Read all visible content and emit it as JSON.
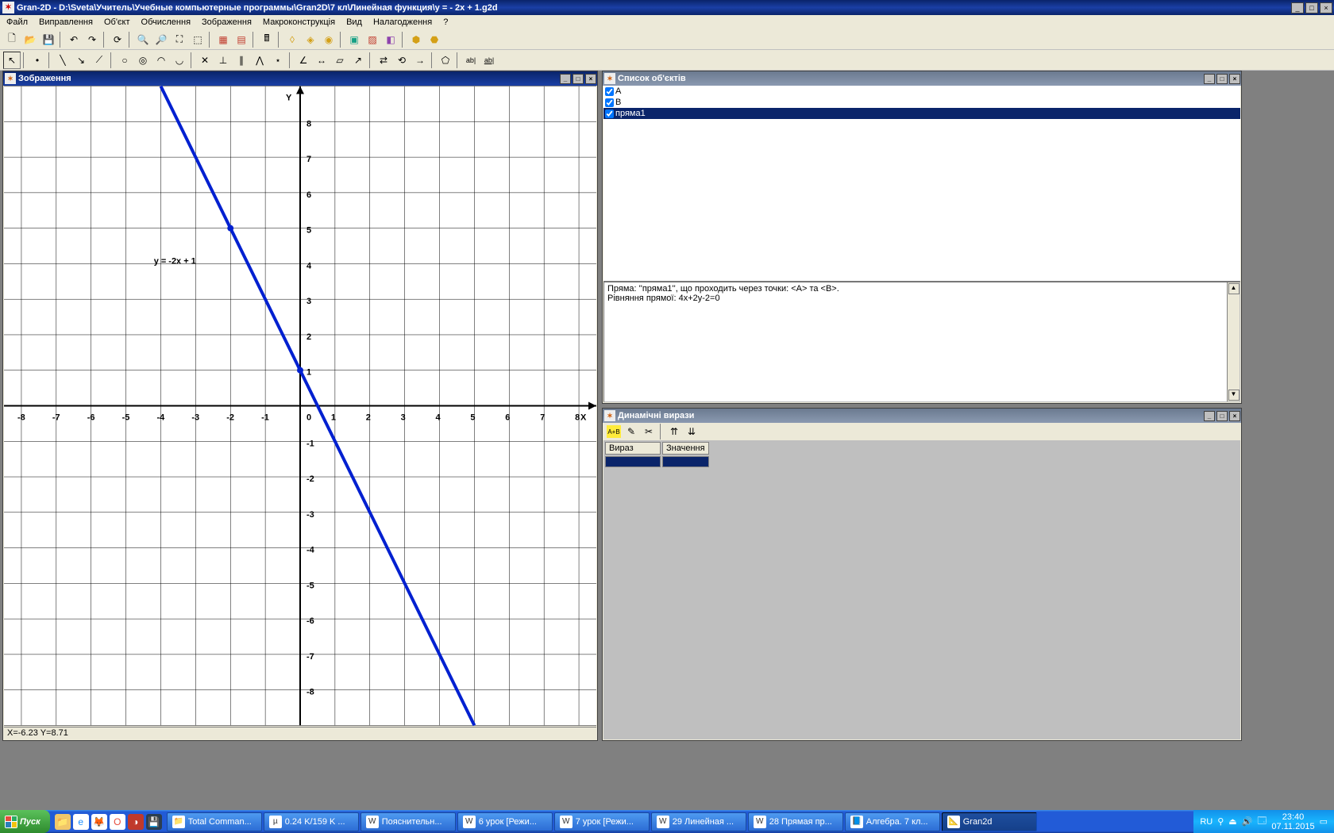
{
  "titlebar": {
    "app": "Gran-2D",
    "path": " - D:\\Sveta\\Учитель\\Учебные компьютерные программы\\Gran2D\\7 кл\\Линейная функция\\y = - 2x + 1.g2d"
  },
  "menu": [
    "Файл",
    "Виправлення",
    "Об'єкт",
    "Обчислення",
    "Зображення",
    "Макроконструкція",
    "Вид",
    "Налагодження",
    "?"
  ],
  "panels": {
    "plot": {
      "title": "Зображення",
      "status": "X=-6.23 Y=8.71"
    },
    "list": {
      "title": "Список об'єктів",
      "items": [
        {
          "label": "A",
          "checked": true,
          "selected": false
        },
        {
          "label": "B",
          "checked": true,
          "selected": false
        },
        {
          "label": "пряма1",
          "checked": true,
          "selected": true
        }
      ],
      "info1": "Пряма: ''пряма1'', що проходить через точки: <A> та <B>.",
      "info2": "Рівняння прямої: 4x+2y-2=0"
    },
    "dyn": {
      "title": "Динамічні вирази",
      "col1": "Вираз",
      "col2": "Значення"
    }
  },
  "chart_data": {
    "type": "line",
    "title": "y = -2x + 1",
    "xlabel": "X",
    "ylabel": "Y",
    "xlim": [
      -8.5,
      8.5
    ],
    "ylim": [
      -9,
      9
    ],
    "xticks": [
      -8,
      -7,
      -6,
      -5,
      -4,
      -3,
      -2,
      -1,
      0,
      1,
      2,
      3,
      4,
      5,
      6,
      7,
      8
    ],
    "yticks": [
      -8,
      -7,
      -6,
      -5,
      -4,
      -3,
      -2,
      -1,
      1,
      2,
      3,
      4,
      5,
      6,
      7,
      8
    ],
    "series": [
      {
        "name": "y = -2x + 1",
        "slope": -2,
        "intercept": 1,
        "points": [
          [
            -4,
            9
          ],
          [
            5,
            -9
          ]
        ]
      }
    ],
    "equation_label": "y = -2x + 1"
  },
  "taskbar": {
    "start": "Пуск",
    "items": [
      {
        "label": "Total Comman...",
        "icon": "📁"
      },
      {
        "label": "0.24 K/159 K ...",
        "icon": "µ"
      },
      {
        "label": "Пояснительн...",
        "icon": "W"
      },
      {
        "label": "6 урок [Режи...",
        "icon": "W"
      },
      {
        "label": "7 урок [Режи...",
        "icon": "W"
      },
      {
        "label": "29 Линейная ...",
        "icon": "W"
      },
      {
        "label": "28 Прямая пр...",
        "icon": "W"
      },
      {
        "label": "Алгебра. 7 кл...",
        "icon": "📘"
      },
      {
        "label": "Gran2d",
        "icon": "📐",
        "active": true
      }
    ],
    "lang": "RU",
    "time": "23:40",
    "date": "07.11.2015"
  },
  "winbtns": {
    "min": "_",
    "max": "□",
    "close": "×"
  }
}
